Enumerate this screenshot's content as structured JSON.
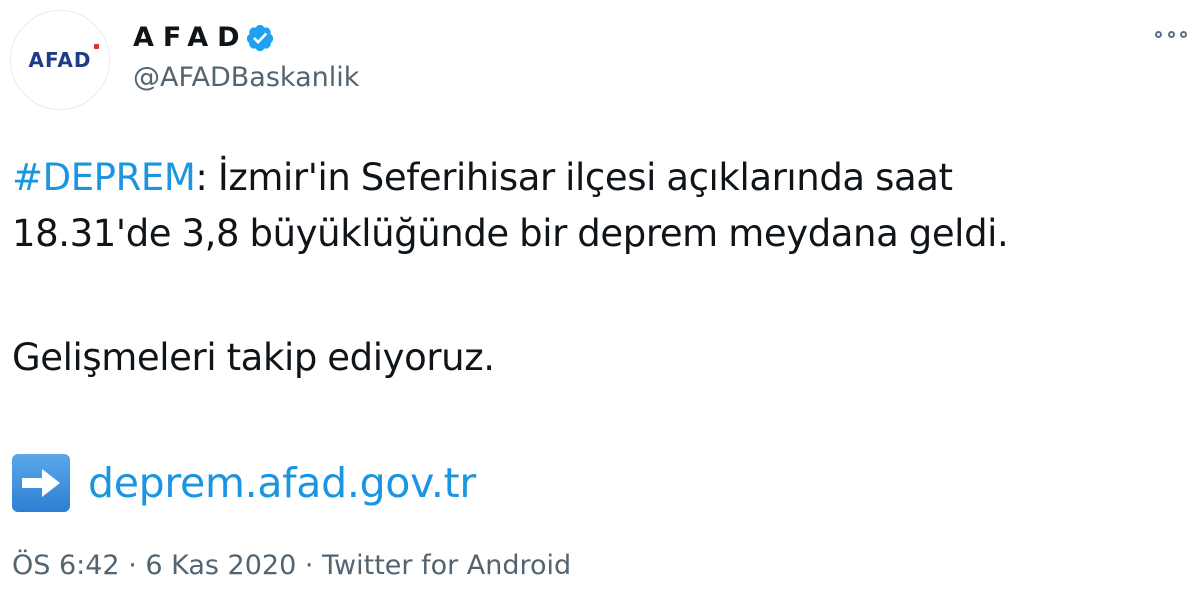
{
  "author": {
    "display_name": "AFAD",
    "handle": "@AFADBaskanlik",
    "avatar_text": "AFAD",
    "verified": true
  },
  "tweet": {
    "hashtag": "#DEPREM",
    "line1_rest": ": İzmir'in Seferihisar ilçesi açıklarında saat",
    "line2": "18.31'de 3,8 büyüklüğünde bir deprem meydana geldi.",
    "line3": "Gelişmeleri takip ediyoruz.",
    "link_text": "deprem.afad.gov.tr",
    "link_icon": "right-arrow-emoji-icon"
  },
  "meta": {
    "time": "ÖS 6:42",
    "date": "6 Kas 2020",
    "source": "Twitter for Android",
    "separator": " · "
  },
  "icons": {
    "more": "more-options-icon",
    "verified": "verified-badge-icon"
  },
  "colors": {
    "link": "#1b95e0",
    "text": "#0f1419",
    "muted": "#536471",
    "verified": "#1da1f2",
    "logo_blue": "#1f3c88",
    "logo_red": "#e0312f"
  }
}
